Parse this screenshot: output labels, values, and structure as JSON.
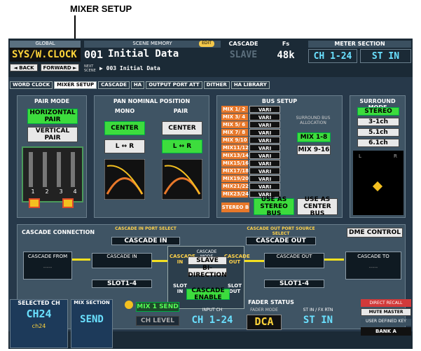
{
  "callout": "MIXER SETUP",
  "global": {
    "label": "GLOBAL",
    "name": "SYS/W.CLOCK",
    "back": "◄ BACK",
    "forward": "FORWARD ►"
  },
  "scene": {
    "label": "SCENE MEMORY",
    "edit": "EDIT",
    "number": "001",
    "name": "Initial Data",
    "next_label": "NEXT SCENE",
    "next": "▶ 003 Initial Data"
  },
  "cascade_top": {
    "label": "CASCADE",
    "value": "SLAVE"
  },
  "fs": {
    "label": "Fs",
    "value": "48k"
  },
  "meter": {
    "label": "METER SECTION",
    "a": "CH 1-24",
    "b": "ST IN"
  },
  "tabs": [
    "WORD CLOCK",
    "MIXER SETUP",
    "CASCADE",
    "HA",
    "OUTPUT PORT ATT",
    "DITHER",
    "HA LIBRARY"
  ],
  "pair_mode": {
    "title": "PAIR MODE",
    "horizontal": "HORIZONTAL PAIR",
    "vertical": "VERTICAL PAIR",
    "nums": [
      "1",
      "2",
      "3",
      "4"
    ]
  },
  "pan": {
    "title": "PAN NOMINAL POSITION",
    "mono": "MONO",
    "pair": "PAIR",
    "center": "CENTER",
    "lr": "L ↔ R",
    "l": "L",
    "r": "R"
  },
  "bus": {
    "title": "BUS SETUP",
    "rows": [
      "MIX 1/ 2",
      "MIX 3/ 4",
      "MIX 5/ 6",
      "MIX 7/ 8",
      "MIX 9/10",
      "MIX11/12",
      "MIX13/14",
      "MIX15/16",
      "MIX17/18",
      "MIX19/20",
      "MIX21/22",
      "MIX23/24"
    ],
    "vari": "VARI",
    "alloc": "SURROUND BUS ALLOCATION",
    "mix18": "MIX 1-8",
    "mix916": "MIX 9-16",
    "stereo_b": "STEREO B",
    "use_stereo": "USE AS STEREO BUS",
    "use_center": "USE AS CENTER BUS"
  },
  "surround": {
    "title": "SURROUND MODE",
    "opts": [
      "STEREO",
      "3-1ch",
      "5.1ch",
      "6.1ch"
    ],
    "l": "L",
    "r": "R"
  },
  "cascade": {
    "title": "CASCADE CONNECTION",
    "in_port_label": "CASCADE IN PORT SELECT",
    "in_port": "CASCADE IN",
    "out_port_label": "CASCADE OUT PORT SOURCE SELECT",
    "out_port": "CASCADE OUT",
    "dme": "DME CONTROL",
    "from": "CASCADE FROM",
    "to": "CASCADE TO",
    "in": "CASCADE IN",
    "out": "CASCADE OUT",
    "slot": "SLOT1-4",
    "slot_in": "SLOT IN",
    "slot_out": "SLOT OUT",
    "casc_in": "CASCADE IN",
    "casc_out": "CASCADE OUT",
    "mode_label": "CASCADE MODE",
    "mode": "SLAVE",
    "bidir": "BI-DIRECTION",
    "enable": "CASCADE ENABLE",
    "dash": "-----"
  },
  "bottom": {
    "sel_label": "SELECTED CH",
    "sel": "CH24",
    "sel_sub": "ch24",
    "mix_label": "MIX SECTION",
    "send": "SEND",
    "mixsend": "MIX 1 SEND",
    "chlevel": "CH LEVEL",
    "fader_label": "FADER STATUS",
    "input_label": "INPUT CH",
    "fader_mode": "FADER MODE",
    "st_label": "ST IN / FX RTN",
    "ch124": "CH 1-24",
    "dca": "DCA",
    "stin": "ST IN",
    "direct": "DIRECT RECALL",
    "mute": "MUTE MASTER",
    "userkey": "USER DEFINED KEY",
    "bank": "BANK A"
  }
}
